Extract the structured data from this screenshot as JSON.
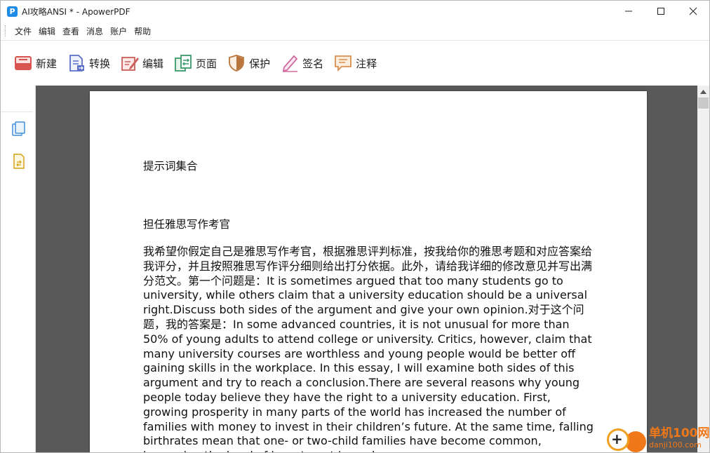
{
  "window": {
    "app_icon_letter": "P",
    "title": "AI攻略ANSI * - ApowerPDF"
  },
  "menu": {
    "items": [
      "文件",
      "编辑",
      "查看",
      "消息",
      "账户",
      "帮助"
    ]
  },
  "toolbar": {
    "buttons": [
      {
        "label": "新建",
        "icon": "new-document-icon",
        "color": "#d9534f"
      },
      {
        "label": "转换",
        "icon": "convert-icon",
        "color": "#5b6fc7"
      },
      {
        "label": "编辑",
        "icon": "edit-icon",
        "color": "#c9605a"
      },
      {
        "label": "页面",
        "icon": "pages-icon",
        "color": "#3a9a6a"
      },
      {
        "label": "保护",
        "icon": "shield-icon",
        "color": "#b8743a"
      },
      {
        "label": "签名",
        "icon": "signature-icon",
        "color": "#d06aa0"
      },
      {
        "label": "注释",
        "icon": "comment-icon",
        "color": "#d99050"
      }
    ]
  },
  "sidebar": {
    "icons": [
      "thumbnails-icon",
      "attachments-icon"
    ]
  },
  "document": {
    "heading": "提示词集合",
    "subheading": "担任雅思写作考官",
    "body": "我希望你假定自己是雅思写作考官，根据雅思评判标准，按我给你的雅思考题和对应答案给我评分，并且按照雅思写作评分细则给出打分依据。此外，请给我详细的修改意见并写出满分范文。第一个问题是：It is sometimes argued that too many students go to university, while others claim that a university education should be a universal right.Discuss both sides of the argument and give your own opinion.对于这个问题，我的答案是：In some advanced countries, it is not unusual for more than 50% of young adults to attend college or university. Critics, however, claim that many university courses are worthless and young people would be better off gaining skills in the workplace. In this essay, I will examine both sides of this argument and try to reach a conclusion.There are several reasons why young people today believe they have the right to a university education. First, growing prosperity in many parts of the world has increased the number of families with money to invest in their children’s future. At the same time, falling birthrates mean that one- or two-child families have become common, increasing the level of investment in each"
  },
  "watermark": {
    "title": "单机100网",
    "url": "danji100.com"
  },
  "colors": {
    "viewer_background": "#595959",
    "watermark": "#f07818"
  }
}
